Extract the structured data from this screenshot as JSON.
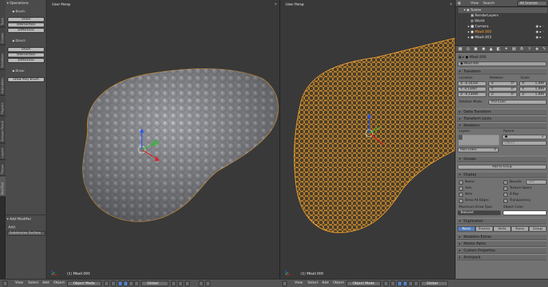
{
  "tabs": [
    "Tools",
    "Create",
    "Relations",
    "Animation",
    "Physics",
    "Grease Pencil",
    "Layers",
    "Tissue",
    "BoolTool"
  ],
  "shelf": {
    "operations": "Operations",
    "brush_label": "Brush:",
    "brush_buttons": [
      "Union",
      "Intersection",
      "Difference"
    ],
    "direct_label": "Direct:",
    "direct_buttons": [
      "Union",
      "Intersection",
      "Difference"
    ],
    "draw_label": "Draw:",
    "draw_button": "Draw Poly Brush",
    "add_modifier": "Add Modifier",
    "add_label": "Add:",
    "add_value": "Subdivision Surface"
  },
  "viewport_left": {
    "title": "User Persp",
    "object_name": "(1) Mball.000"
  },
  "viewport_right": {
    "title": "User Persp",
    "object_name": "(1) Mball.000"
  },
  "header": {
    "view": "View",
    "select": "Select",
    "add": "Add",
    "object": "Object",
    "mode": "Object Mode",
    "orientation": "Global"
  },
  "outliner": {
    "menu_view": "View",
    "menu_search": "Search",
    "scenes": "All Scenes",
    "rows": [
      "Scene",
      "RenderLayers",
      "World",
      "Camera",
      "Mball.000",
      "Mball.003"
    ]
  },
  "properties": {
    "object_name": "Mball.000",
    "breadcrumb": "Mball.000",
    "transform": "Transform",
    "location_label": "Location:",
    "rotation_label": "Rotation:",
    "scale_label": "Scale:",
    "location": [
      "X: -0.16316",
      "Y: -0.53087",
      "Z: -0.13099"
    ],
    "rotation": [
      "X:",
      "Y:",
      "Z:"
    ],
    "rotation_vals": [
      "0°",
      "0°",
      "0°"
    ],
    "scale": [
      "X:",
      "Y:",
      "Z:"
    ],
    "scale_vals": [
      "1.499",
      "1.499",
      "1.499"
    ],
    "rotation_mode_label": "Rotation Mode:",
    "rotation_mode": "XYZ Euler",
    "delta_transform": "Delta Transform",
    "transform_locks": "Transform Locks",
    "relations": "Relations",
    "layers_label": "Layers:",
    "parent_label": "Parent:",
    "parent_placeholder": "Object",
    "pass_index": "Pass Index:",
    "pass_index_value": "0",
    "groups": "Groups",
    "add_to_group": "Add to Group",
    "display": "Display",
    "display_left": [
      "Name",
      "Axis",
      "Wire",
      "Draw All Edges"
    ],
    "display_right": [
      "Bounds",
      "Texture Space",
      "X-Ray",
      "Transparency"
    ],
    "bounds_type": "Box",
    "max_draw_type_label": "Maximum Draw Type:",
    "max_draw_type": "Textured",
    "object_color_label": "Object Color:",
    "duplication": "Duplication",
    "dup_buttons": [
      "None",
      "Frames",
      "Verts",
      "Faces",
      "Group"
    ],
    "rel_extras": "Relations Extras",
    "motion_paths": "Motion Paths",
    "custom_props": "Custom Properties",
    "bottom": "Archipack"
  },
  "colors": {
    "accent": "#5680c2",
    "wire": "#f0a030",
    "mesh": "#9a9ba0"
  }
}
